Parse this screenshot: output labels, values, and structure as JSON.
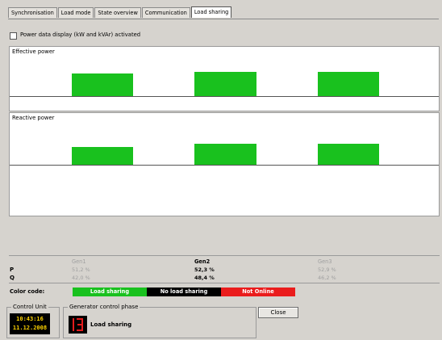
{
  "tabs": [
    {
      "label": "Synchronisation",
      "active": false
    },
    {
      "label": "Load mode",
      "active": false
    },
    {
      "label": "State overview",
      "active": false
    },
    {
      "label": "Communication",
      "active": false
    },
    {
      "label": "Load sharing",
      "active": true
    }
  ],
  "power_display_checkbox": {
    "label": "Power data display (kW and kVAr) activated",
    "checked": false
  },
  "effective_power": {
    "title": "Effective power",
    "level_of_max_percent": [
      47,
      50,
      50
    ]
  },
  "reactive_power": {
    "title": "Reactive power",
    "level_of_max_percent": [
      36,
      43,
      43
    ]
  },
  "bar_color": "#19c11e",
  "generators": [
    {
      "name": "Gen1",
      "p": "51,2 %",
      "q": "42,0 %",
      "highlight": false
    },
    {
      "name": "Gen2",
      "p": "52,3 %",
      "q": "48,4 %",
      "highlight": true
    },
    {
      "name": "Gen3",
      "p": "52,9 %",
      "q": "46,2 %",
      "highlight": false
    }
  ],
  "row_labels": {
    "p": "P",
    "q": "Q"
  },
  "color_code": {
    "label": "Color code:",
    "items": [
      {
        "label": "Load sharing",
        "color": "#19c11e"
      },
      {
        "label": "No load sharing",
        "color": "#000000"
      },
      {
        "label": "Not Online",
        "color": "#ea1c1c"
      }
    ]
  },
  "control_unit": {
    "title": "Control Unit",
    "time": "10:43:16",
    "date": "11.12.2008"
  },
  "generator_control_phase": {
    "title": "Generator control phase",
    "value": "Load sharing"
  },
  "close_label": "Close"
}
